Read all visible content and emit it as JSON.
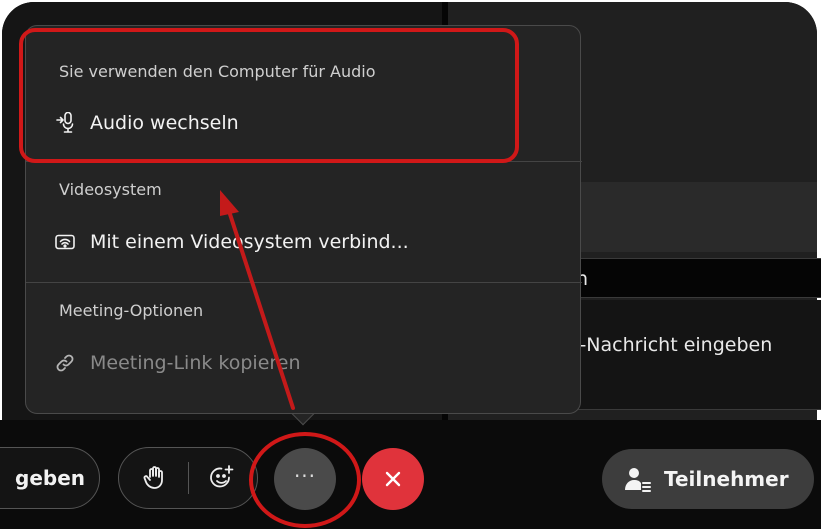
{
  "chat": {
    "field_top_text": "n",
    "field_input_text": "t-Nachricht eingeben"
  },
  "menu": {
    "audio": {
      "section_label": "Sie verwenden den Computer für Audio",
      "item_label": "Audio wechseln",
      "item_icon": "audio-switch-icon"
    },
    "video": {
      "section_label": "Videosystem",
      "item_label": "Mit einem Videosystem verbind...",
      "item_icon": "video-system-icon"
    },
    "options": {
      "section_label": "Meeting-Optionen",
      "item_label": "Meeting-Link kopieren",
      "item_icon": "link-icon"
    }
  },
  "toolbar": {
    "share_label_partial": "geben",
    "raise_hand_icon": "raise-hand-icon",
    "reactions_icon": "reactions-icon",
    "more_label": "···",
    "end_call_icon": "close-icon",
    "participants_label": "Teilnehmer",
    "participants_icon": "participants-icon"
  },
  "colors": {
    "menu_bg": "#242424",
    "end_call": "#e0333b",
    "annotation": "#d01818"
  }
}
